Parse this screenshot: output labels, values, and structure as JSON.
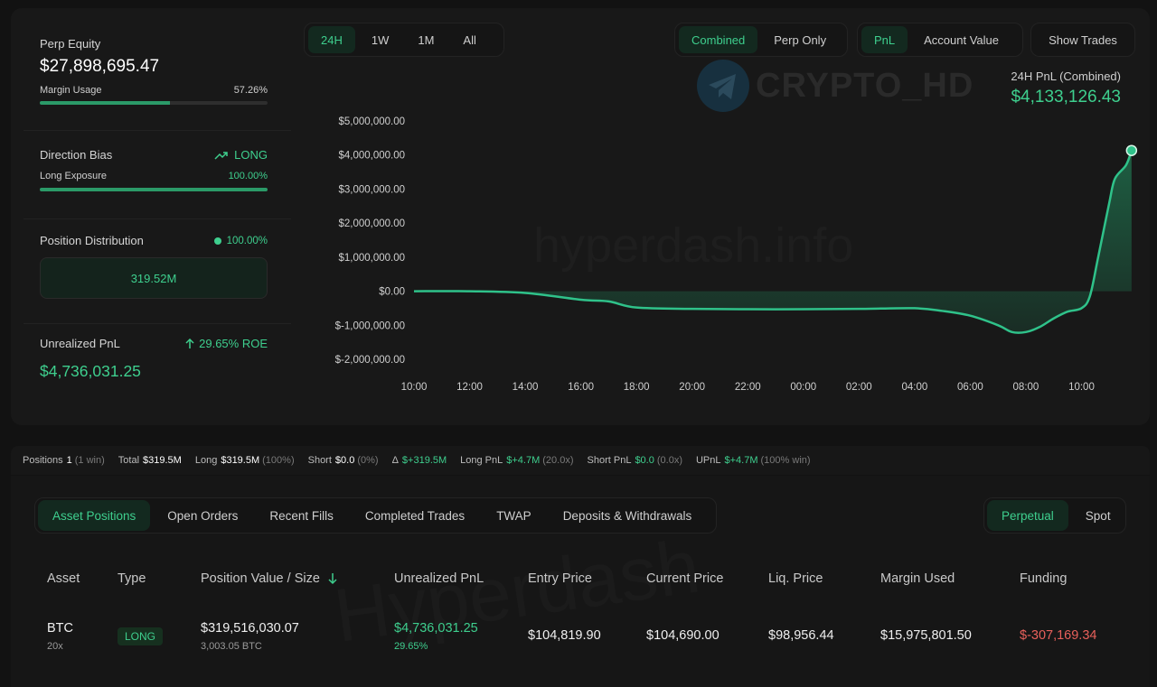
{
  "summary": {
    "perp_equity_label": "Perp Equity",
    "perp_equity_value": "$27,898,695.47",
    "margin_usage_label": "Margin Usage",
    "margin_usage_value": "57.26%",
    "margin_usage_fraction": 0.5726,
    "direction_bias_label": "Direction Bias",
    "direction_bias_value": "LONG",
    "long_exposure_label": "Long Exposure",
    "long_exposure_value": "100.00%",
    "long_exposure_fraction": 1.0,
    "position_distribution_label": "Position Distribution",
    "position_distribution_value": "100.00%",
    "position_distribution_total": "319.52M",
    "unrealized_pnl_label": "Unrealized PnL",
    "unrealized_pnl_roe": "29.65% ROE",
    "unrealized_pnl_value": "$4,736,031.25"
  },
  "timeframes": [
    "24H",
    "1W",
    "1M",
    "All"
  ],
  "timeframe_active": 0,
  "modes": [
    "Combined",
    "Perp Only"
  ],
  "mode_active": 0,
  "metrics": [
    "PnL",
    "Account Value"
  ],
  "metric_active": 0,
  "show_trades_label": "Show Trades",
  "watermark_logo": "CRYPTO_HD",
  "watermark_site": "hyperdash.info",
  "watermark_bottom": "Hyperdash",
  "pnl_header": {
    "label": "24H PnL (Combined)",
    "value": "$4,133,126.43"
  },
  "chart_data": {
    "type": "area",
    "y_ticks": [
      "$5,000,000.00",
      "$4,000,000.00",
      "$3,000,000.00",
      "$2,000,000.00",
      "$1,000,000.00",
      "$0.00",
      "$-1,000,000.00",
      "$-2,000,000.00"
    ],
    "x_ticks": [
      "10:00",
      "12:00",
      "14:00",
      "16:00",
      "18:00",
      "20:00",
      "22:00",
      "00:00",
      "02:00",
      "04:00",
      "06:00",
      "08:00",
      "10:00"
    ],
    "ylim": [
      -2000000,
      5000000
    ],
    "x_hours": [
      0,
      2,
      4,
      6,
      7,
      8,
      10,
      12,
      14,
      16,
      18,
      19,
      20,
      21,
      21.5,
      22,
      22.5,
      23,
      23.5,
      24,
      24.3,
      24.6,
      25,
      25.2,
      25.6,
      25.8
    ],
    "values": [
      0,
      0,
      -50000,
      -250000,
      -300000,
      -480000,
      -520000,
      -530000,
      -530000,
      -520000,
      -500000,
      -580000,
      -720000,
      -1000000,
      -1200000,
      -1200000,
      -1050000,
      -800000,
      -600000,
      -500000,
      -150000,
      1000000,
      2600000,
      3300000,
      3700000,
      4133126.43
    ],
    "line_color": "#2fc28a",
    "fill_color": "#1f6b4a",
    "grid": false
  },
  "stats": [
    {
      "label": "Positions",
      "value": "1",
      "note": "(1 win)",
      "green": false
    },
    {
      "label": "Total",
      "value": "$319.5M",
      "note": "",
      "green": false
    },
    {
      "label": "Long",
      "value": "$319.5M",
      "note": "(100%)",
      "green": false
    },
    {
      "label": "Short",
      "value": "$0.0",
      "note": "(0%)",
      "green": false
    },
    {
      "label": "Δ",
      "value": "$+319.5M",
      "note": "",
      "green": true
    },
    {
      "label": "Long PnL",
      "value": "$+4.7M",
      "note": "(20.0x)",
      "green": true
    },
    {
      "label": "Short PnL",
      "value": "$0.0",
      "note": "(0.0x)",
      "green": true
    },
    {
      "label": "UPnL",
      "value": "$+4.7M",
      "note": "(100% win)",
      "green": true
    }
  ],
  "tabs": [
    "Asset Positions",
    "Open Orders",
    "Recent Fills",
    "Completed Trades",
    "TWAP",
    "Deposits & Withdrawals"
  ],
  "tab_active": 0,
  "market_tabs": [
    "Perpetual",
    "Spot"
  ],
  "market_active": 0,
  "table": {
    "headers": [
      "Asset",
      "Type",
      "Position Value / Size",
      "Unrealized PnL",
      "Entry Price",
      "Current Price",
      "Liq. Price",
      "Margin Used",
      "Funding"
    ],
    "sort_icon": "arrow-down-icon",
    "row": {
      "asset": "BTC",
      "leverage": "20x",
      "type": "LONG",
      "position_value": "$319,516,030.07",
      "position_size": "3,003.05 BTC",
      "unrealized_pnl": "$4,736,031.25",
      "unrealized_pct": "29.65%",
      "entry_price": "$104,819.90",
      "current_price": "$104,690.00",
      "liq_price": "$98,956.44",
      "margin_used": "$15,975,801.50",
      "funding": "$-307,169.34"
    }
  },
  "colors": {
    "accent": "#3ecf8e",
    "negative": "#e8605b",
    "background": "#121212"
  }
}
